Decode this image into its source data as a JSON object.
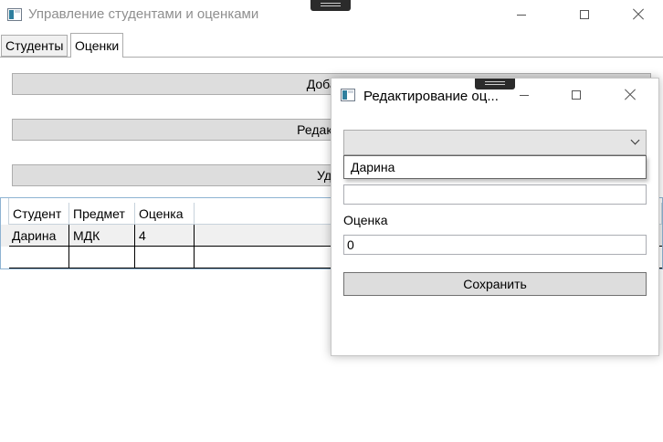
{
  "window": {
    "title": "Управление студентами и оценками"
  },
  "tabs": [
    {
      "label": "Студенты",
      "active": false
    },
    {
      "label": "Оценки",
      "active": true
    }
  ],
  "actions": {
    "add_visible": "Добавит",
    "edit_visible": "Редактиров",
    "delete_visible": "Удал"
  },
  "grid": {
    "columns": [
      "Студент",
      "Предмет",
      "Оценка"
    ],
    "rows": [
      [
        "Дарина",
        "МДК",
        "4"
      ]
    ]
  },
  "dialog": {
    "title": "Редактирование оц...",
    "student_selected": "",
    "student_options": [
      "Дарина"
    ],
    "subject_value": "",
    "grade_label": "Оценка",
    "grade_value": "0",
    "save_label": "Сохранить"
  },
  "colors": {
    "button_bg": "#dddddd",
    "grid_border": "#8eb3d2",
    "selected_row": "#f0f0f0"
  }
}
